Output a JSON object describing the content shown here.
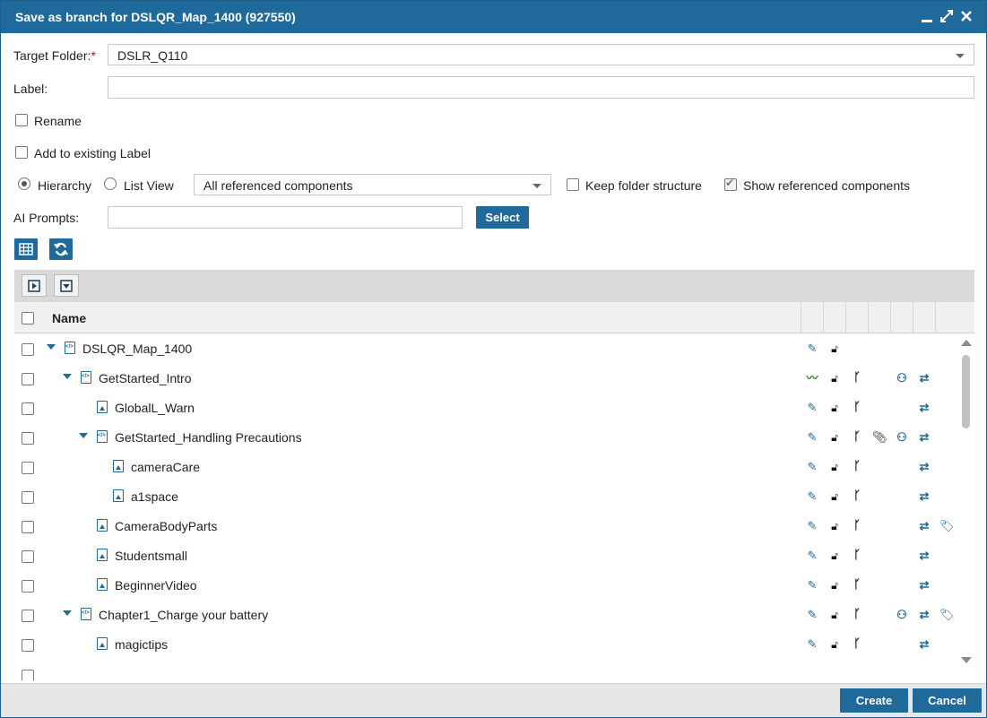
{
  "dialog": {
    "title": "Save as branch for DSLQR_Map_1400 (927550)"
  },
  "form": {
    "target_folder_label": "Target Folder:",
    "required_mark": "*",
    "target_folder_value": "DSLR_Q110",
    "label_label": "Label:",
    "label_value": "",
    "rename_label": "Rename",
    "rename_checked": false,
    "add_label_label": "Add to existing Label",
    "add_label_checked": false,
    "hierarchy_label": "Hierarchy",
    "list_view_label": "List View",
    "view_mode": "Hierarchy",
    "filter_value": "All referenced components",
    "keep_folder_label": "Keep folder structure",
    "keep_folder_checked": false,
    "show_ref_label": "Show referenced components",
    "show_ref_checked": true,
    "ai_prompts_label": "AI Prompts:",
    "ai_prompts_value": "",
    "select_button": "Select"
  },
  "table": {
    "name_header": "Name",
    "rows": [
      {
        "name": "DSLQR_Map_1400",
        "type": "map",
        "level": 0,
        "expandable": true,
        "actions": [
          "edit-icon",
          "unlock-icon"
        ]
      },
      {
        "name": "GetStarted_Intro",
        "type": "map",
        "level": 1,
        "expandable": true,
        "actions": [
          "signature-icon",
          "unlock-icon",
          "branch-icon",
          "binoculars-icon",
          "sync-icon"
        ]
      },
      {
        "name": "GlobalL_Warn",
        "type": "image",
        "level": 2,
        "expandable": false,
        "actions": [
          "edit-icon",
          "unlock-icon",
          "branch-icon",
          "sync-icon"
        ]
      },
      {
        "name": "GetStarted_Handling Precautions",
        "type": "map",
        "level": 2,
        "expandable": true,
        "actions": [
          "edit-icon",
          "unlock-icon",
          "branch-icon",
          "paperclip-icon",
          "binoculars-icon",
          "sync-icon"
        ]
      },
      {
        "name": "cameraCare",
        "type": "image",
        "level": 3,
        "expandable": false,
        "actions": [
          "edit-icon",
          "unlock-icon",
          "branch-icon",
          "sync-icon"
        ]
      },
      {
        "name": "a1space",
        "type": "image",
        "level": 3,
        "expandable": false,
        "actions": [
          "edit-icon",
          "unlock-icon",
          "branch-icon",
          "sync-icon"
        ]
      },
      {
        "name": "CameraBodyParts",
        "type": "image",
        "level": 2,
        "expandable": false,
        "actions": [
          "edit-icon",
          "unlock-icon",
          "branch-icon",
          "sync-icon",
          "tag-icon"
        ]
      },
      {
        "name": "Studentsmall",
        "type": "image",
        "level": 2,
        "expandable": false,
        "actions": [
          "edit-icon",
          "unlock-icon",
          "branch-icon",
          "sync-icon"
        ]
      },
      {
        "name": "BeginnerVideo",
        "type": "image",
        "level": 2,
        "expandable": false,
        "actions": [
          "edit-icon",
          "unlock-icon",
          "branch-icon",
          "sync-icon"
        ]
      },
      {
        "name": "Chapter1_Charge your battery",
        "type": "map",
        "level": 1,
        "expandable": true,
        "actions": [
          "edit-icon",
          "unlock-icon",
          "branch-icon",
          "binoculars-icon",
          "sync-icon",
          "tag-icon"
        ]
      },
      {
        "name": "magictips",
        "type": "image",
        "level": 2,
        "expandable": false,
        "actions": [
          "edit-icon",
          "unlock-icon",
          "branch-icon",
          "sync-icon"
        ]
      }
    ]
  },
  "footer": {
    "create_label": "Create",
    "cancel_label": "Cancel"
  },
  "icons": {
    "minimize": "minimize-icon",
    "maximize": "maximize-icon",
    "close": "close-icon",
    "grid": "grid-icon",
    "refresh": "refresh-icon",
    "expand_all": "expand-all-icon",
    "collapse_all": "collapse-all-icon"
  },
  "colors": {
    "accent": "#1f6a9a",
    "signature": "#2e8b2e",
    "required": "#dd0000"
  }
}
